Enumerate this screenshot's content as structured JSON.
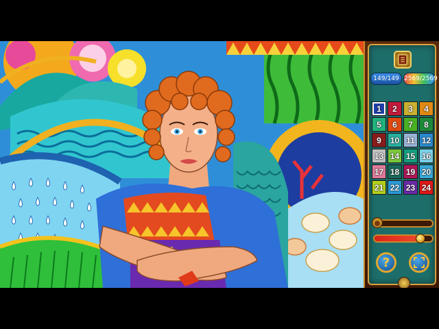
{
  "game": {
    "progress_counter": "149/149",
    "hint_counter": "2569/2569",
    "selected_color": 1,
    "zoom_level": 0.1,
    "brush_size": 0.8
  },
  "palette": [
    {
      "n": "1",
      "color": "#1f3fa8"
    },
    {
      "n": "2",
      "color": "#c21a3a"
    },
    {
      "n": "3",
      "color": "#c9b032"
    },
    {
      "n": "4",
      "color": "#e08a14"
    },
    {
      "n": "5",
      "color": "#21b27e"
    },
    {
      "n": "6",
      "color": "#e04a10"
    },
    {
      "n": "7",
      "color": "#4ab023"
    },
    {
      "n": "8",
      "color": "#1f8a3a"
    },
    {
      "n": "9",
      "color": "#8a1c1c"
    },
    {
      "n": "10",
      "color": "#28b0a0"
    },
    {
      "n": "11",
      "color": "#9ab4d8"
    },
    {
      "n": "12",
      "color": "#2a8ad0"
    },
    {
      "n": "13",
      "color": "#c0c0c0"
    },
    {
      "n": "14",
      "color": "#7ac83a"
    },
    {
      "n": "15",
      "color": "#14a080"
    },
    {
      "n": "16",
      "color": "#7ad0e8"
    },
    {
      "n": "17",
      "color": "#e07a9a"
    },
    {
      "n": "18",
      "color": "#1a6a5a"
    },
    {
      "n": "19",
      "color": "#b01858"
    },
    {
      "n": "20",
      "color": "#3aa8d8"
    },
    {
      "n": "21",
      "color": "#b4d01c"
    },
    {
      "n": "22",
      "color": "#2a9ad8"
    },
    {
      "n": "23",
      "color": "#6a2aa8"
    },
    {
      "n": "24",
      "color": "#e01818"
    }
  ],
  "buttons": {
    "hint_label": "?"
  },
  "icons": {
    "menu": "book-icon",
    "zoom": "magnifier-icon",
    "brush": "brush-size-icon",
    "hint": "question-icon",
    "fullscreen": "expand-arrows-icon",
    "compass": "compass-icon"
  }
}
